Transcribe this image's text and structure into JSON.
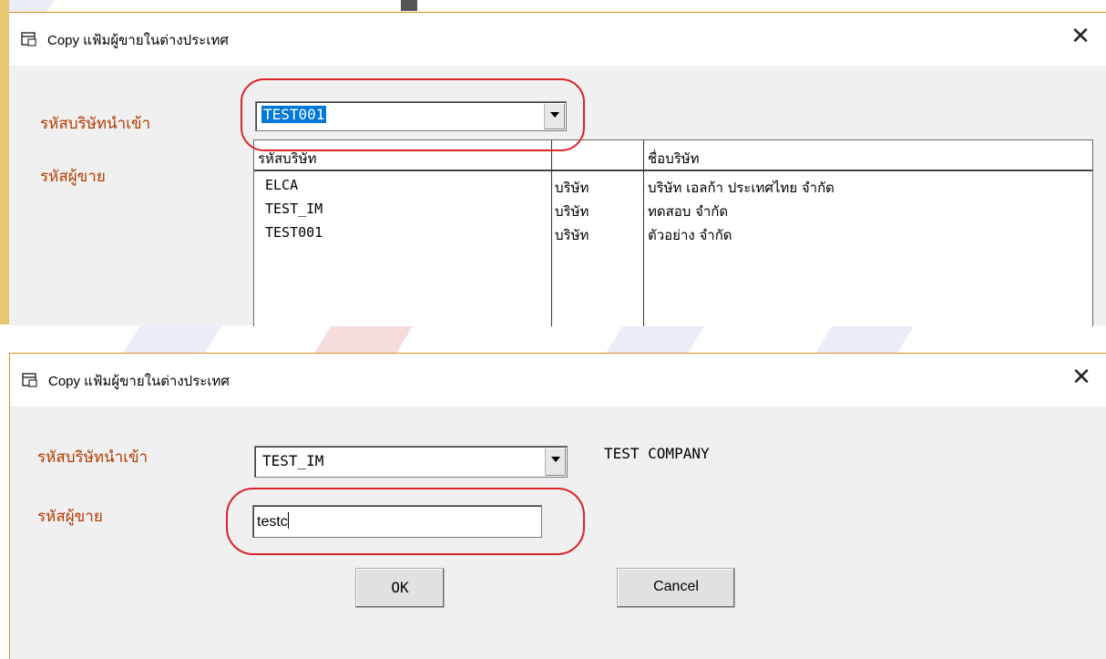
{
  "colors": {
    "accent_border": "#e08a1e",
    "label_color": "#b23b00",
    "highlight_circle": "#d9252b",
    "selection": "#0078d7"
  },
  "dialog_top": {
    "title": "Copy แฟ้มผู้ขายในต่างประเทศ",
    "close_icon": "close-x-icon",
    "importer_label": "รหัสบริษัทนำเข้า",
    "seller_label": "รหัสผู้ขาย",
    "importer_combo_value": "TEST001",
    "grid": {
      "headers": [
        "รหัสบริษัท",
        "",
        "ชื่อบริษัท"
      ],
      "rows": [
        {
          "code": "ELCA",
          "type": "บริษัท",
          "name": "บริษัท เอลก้า ประเทศไทย จำกัด"
        },
        {
          "code": "TEST_IM",
          "type": "บริษัท",
          "name": "ทดสอบ จำกัด"
        },
        {
          "code": "TEST001",
          "type": "บริษัท",
          "name": "ตัวอย่าง จำกัด"
        }
      ]
    }
  },
  "dialog_bottom": {
    "title": "Copy แฟ้มผู้ขายในต่างประเทศ",
    "close_icon": "close-x-icon",
    "importer_label": "รหัสบริษัทนำเข้า",
    "seller_label": "รหัสผู้ขาย",
    "importer_combo_value": "TEST_IM",
    "company_name": "TEST COMPANY",
    "seller_input_value": "testc",
    "ok_label": "OK",
    "cancel_label": "Cancel"
  }
}
